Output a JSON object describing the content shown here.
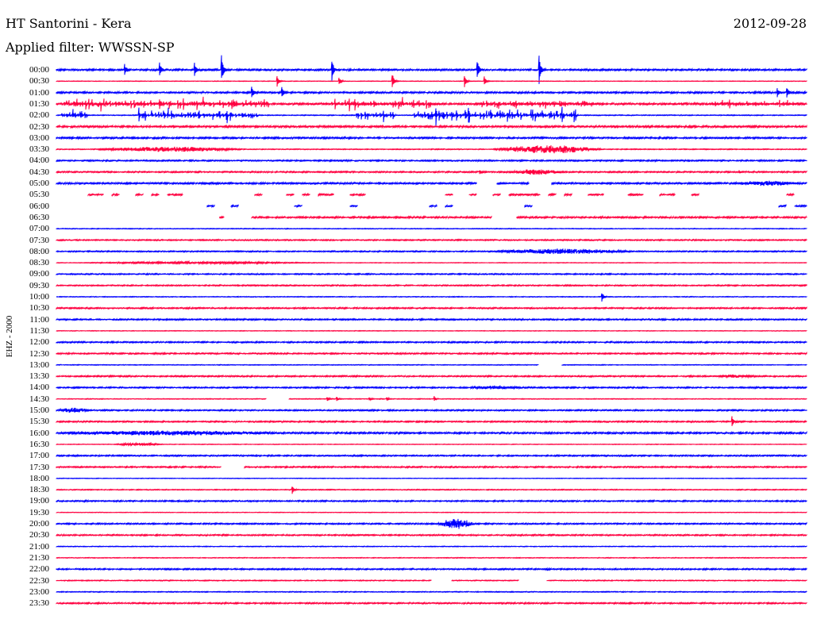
{
  "header": {
    "title": "HT Santorini - Kera",
    "date": "2012-09-28",
    "filter": "Applied filter: WWSSN-SP"
  },
  "chart_data": {
    "type": "line",
    "subtype": "helicorder",
    "ylabel": "EHZ - 2000",
    "minutes_per_row": 30,
    "colors": {
      "even": "#0000ff",
      "odd": "#ff0040"
    },
    "rows": [
      "00:00",
      "00:30",
      "01:00",
      "01:30",
      "02:00",
      "02:30",
      "03:00",
      "03:30",
      "04:00",
      "04:30",
      "05:00",
      "05:30",
      "06:00",
      "06:30",
      "07:00",
      "07:30",
      "08:00",
      "08:30",
      "09:00",
      "09:30",
      "10:00",
      "10:30",
      "11:00",
      "11:30",
      "12:00",
      "12:30",
      "13:00",
      "13:30",
      "14:00",
      "14:30",
      "15:00",
      "15:30",
      "16:00",
      "16:30",
      "17:00",
      "17:30",
      "18:00",
      "18:30",
      "19:00",
      "19:30",
      "20:00",
      "20:30",
      "21:00",
      "21:30",
      "22:00",
      "22:30",
      "23:00",
      "23:30"
    ],
    "noise_counts": [
      100,
      30,
      100,
      120,
      50,
      120,
      100,
      50,
      80,
      80,
      100,
      100,
      100,
      100,
      40,
      70,
      70,
      30,
      70,
      70,
      40,
      80,
      80,
      30,
      80,
      80,
      40,
      80,
      80,
      40,
      80,
      80,
      100,
      30,
      80,
      80,
      30,
      50,
      80,
      30,
      80,
      80,
      40,
      40,
      80,
      50,
      50,
      80
    ],
    "events": [
      {
        "row": "00:00",
        "kind": "spike",
        "minute": 2.7,
        "amp": 1200
      },
      {
        "row": "00:00",
        "kind": "spike",
        "minute": 4.1,
        "amp": 1500
      },
      {
        "row": "00:00",
        "kind": "spike",
        "minute": 5.5,
        "amp": 1400
      },
      {
        "row": "00:00",
        "kind": "spike",
        "minute": 6.6,
        "amp": 2000
      },
      {
        "row": "00:00",
        "kind": "spike",
        "minute": 11.0,
        "amp": 2000
      },
      {
        "row": "00:00",
        "kind": "spike",
        "minute": 16.8,
        "amp": 2200
      },
      {
        "row": "00:00",
        "kind": "spike",
        "minute": 19.3,
        "amp": 2000
      },
      {
        "row": "00:30",
        "kind": "spike",
        "minute": 8.8,
        "amp": 1200
      },
      {
        "row": "00:30",
        "kind": "spike",
        "minute": 11.3,
        "amp": 600
      },
      {
        "row": "00:30",
        "kind": "spike",
        "minute": 13.4,
        "amp": 1800
      },
      {
        "row": "00:30",
        "kind": "spike",
        "minute": 16.3,
        "amp": 1200
      },
      {
        "row": "00:30",
        "kind": "spike",
        "minute": 17.1,
        "amp": 800
      },
      {
        "row": "01:00",
        "kind": "spike",
        "minute": 7.8,
        "amp": 1000
      },
      {
        "row": "01:00",
        "kind": "spike",
        "minute": 9.0,
        "amp": 900
      },
      {
        "row": "01:00",
        "kind": "spike",
        "minute": 28.8,
        "amp": 1000
      },
      {
        "row": "01:00",
        "kind": "spike",
        "minute": 29.2,
        "amp": 800
      },
      {
        "row": "01:30",
        "kind": "swarm",
        "start": 0.3,
        "end": 8.5,
        "amp": 1200
      },
      {
        "row": "01:30",
        "kind": "swarm",
        "start": 11.0,
        "end": 15.0,
        "amp": 1200
      },
      {
        "row": "01:30",
        "kind": "swarm",
        "start": 17.0,
        "end": 21.5,
        "amp": 1000
      },
      {
        "row": "01:30",
        "kind": "swarm",
        "start": 26.0,
        "end": 29.5,
        "amp": 600
      },
      {
        "row": "02:00",
        "kind": "swarm",
        "start": 0.2,
        "end": 1.2,
        "amp": 1500
      },
      {
        "row": "02:00",
        "kind": "swarm",
        "start": 3.3,
        "end": 8.0,
        "amp": 1500
      },
      {
        "row": "02:00",
        "kind": "swarm",
        "start": 12.0,
        "end": 13.5,
        "amp": 1200
      },
      {
        "row": "02:00",
        "kind": "swarm",
        "start": 14.3,
        "end": 20.8,
        "amp": 1800
      },
      {
        "row": "03:30",
        "kind": "burst",
        "start": 1.5,
        "end": 7.5,
        "amp": 300
      },
      {
        "row": "03:30",
        "kind": "burst",
        "start": 17.4,
        "end": 21.9,
        "amp": 500
      },
      {
        "row": "04:30",
        "kind": "spike",
        "minute": 16.9,
        "amp": 400
      },
      {
        "row": "04:30",
        "kind": "burst",
        "start": 18.1,
        "end": 20.3,
        "amp": 300
      },
      {
        "row": "04:30",
        "kind": "spike",
        "minute": 27.3,
        "amp": 200
      },
      {
        "row": "05:00",
        "kind": "burst",
        "start": 27.0,
        "end": 29.8,
        "amp": 250
      },
      {
        "row": "08:00",
        "kind": "burst",
        "start": 17.5,
        "end": 23.0,
        "amp": 300
      },
      {
        "row": "08:30",
        "kind": "burst",
        "start": 0.8,
        "end": 10.5,
        "amp": 120
      },
      {
        "row": "10:00",
        "kind": "spike",
        "minute": 21.8,
        "amp": 800
      },
      {
        "row": "13:30",
        "kind": "burst",
        "start": 26.3,
        "end": 28.0,
        "amp": 150
      },
      {
        "row": "14:00",
        "kind": "burst",
        "start": 16.5,
        "end": 18.8,
        "amp": 200
      },
      {
        "row": "14:30",
        "kind": "spike",
        "minute": 10.8,
        "amp": 400
      },
      {
        "row": "14:30",
        "kind": "spike",
        "minute": 11.2,
        "amp": 300
      },
      {
        "row": "14:30",
        "kind": "spike",
        "minute": 12.5,
        "amp": 300
      },
      {
        "row": "14:30",
        "kind": "spike",
        "minute": 13.2,
        "amp": 250
      },
      {
        "row": "14:30",
        "kind": "spike",
        "minute": 15.1,
        "amp": 400
      },
      {
        "row": "15:00",
        "kind": "burst",
        "start": 0.0,
        "end": 1.4,
        "amp": 250
      },
      {
        "row": "15:30",
        "kind": "spike",
        "minute": 27.0,
        "amp": 900
      },
      {
        "row": "16:00",
        "kind": "burst",
        "start": 0.0,
        "end": 9.0,
        "amp": 250
      },
      {
        "row": "16:30",
        "kind": "burst",
        "start": 2.3,
        "end": 4.3,
        "amp": 150
      },
      {
        "row": "18:30",
        "kind": "spike",
        "minute": 9.4,
        "amp": 900
      },
      {
        "row": "20:00",
        "kind": "burst",
        "start": 15.2,
        "end": 16.8,
        "amp": 600
      },
      {
        "row": "22:00",
        "kind": "spike",
        "minute": 19.6,
        "amp": 150
      }
    ],
    "gaps": [
      {
        "row": "05:00",
        "start": 16.8,
        "end": 17.6
      },
      {
        "row": "05:00",
        "start": 18.9,
        "end": 19.8
      },
      {
        "row": "06:30",
        "start": 0.0,
        "end": 6.5
      },
      {
        "row": "06:30",
        "start": 6.7,
        "end": 7.8
      },
      {
        "row": "06:30",
        "start": 17.4,
        "end": 18.4
      },
      {
        "row": "13:00",
        "start": 19.3,
        "end": 20.2
      },
      {
        "row": "14:30",
        "start": 8.4,
        "end": 9.3
      },
      {
        "row": "17:30",
        "start": 6.6,
        "end": 7.5
      },
      {
        "row": "22:30",
        "start": 15.0,
        "end": 15.8
      },
      {
        "row": "22:30",
        "start": 18.5,
        "end": 19.6
      }
    ],
    "fragmented_rows": [
      "05:30",
      "06:00"
    ]
  }
}
